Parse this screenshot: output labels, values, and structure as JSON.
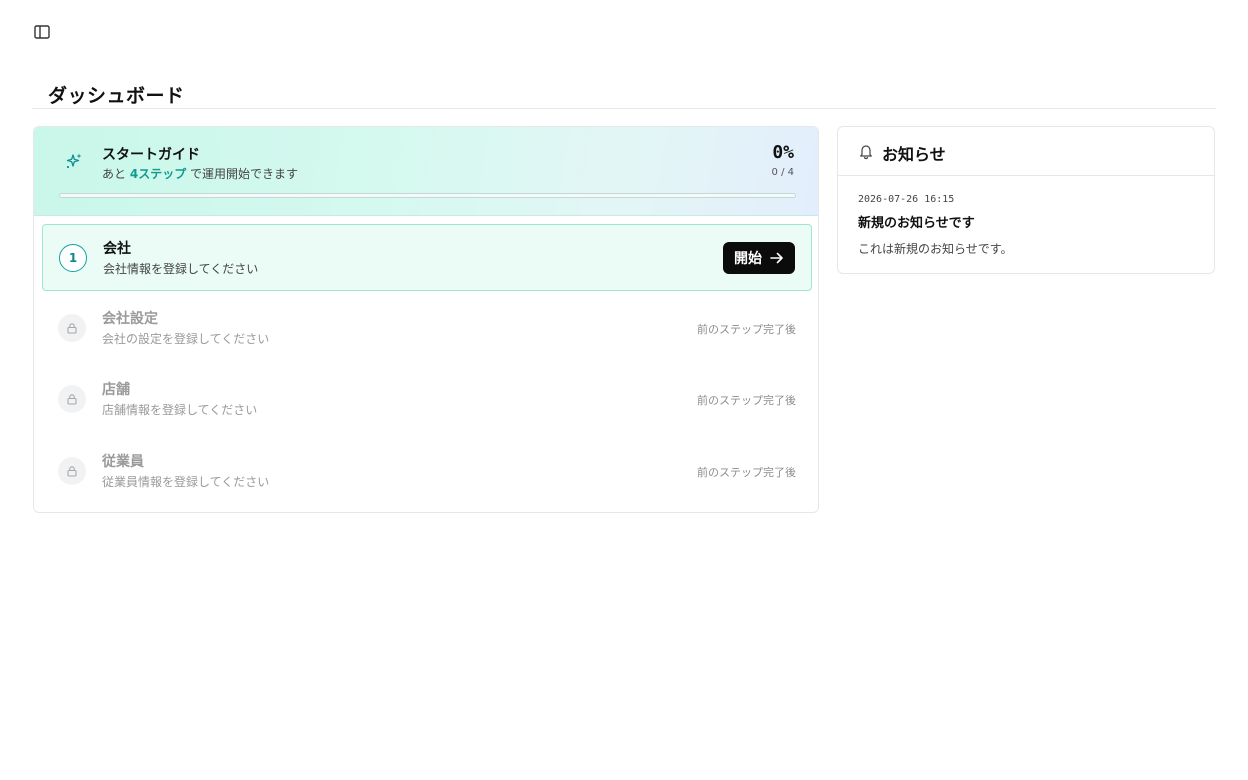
{
  "page": {
    "title": "ダッシュボード"
  },
  "guide": {
    "title": "スタートガイド",
    "subtitle_prefix": "あと",
    "subtitle_highlight": "4ステップ",
    "subtitle_suffix": "で運用開始できます",
    "percent_label": "0%",
    "count_label": "0 / 4",
    "progress_fraction": 0,
    "steps": [
      {
        "number": "1",
        "title": "会社",
        "description": "会社情報を登録してください",
        "state": "active",
        "button_label": "開始"
      },
      {
        "title": "会社設定",
        "description": "会社の設定を登録してください",
        "state": "locked",
        "status": "前のステップ完了後"
      },
      {
        "title": "店舗",
        "description": "店舗情報を登録してください",
        "state": "locked",
        "status": "前のステップ完了後"
      },
      {
        "title": "従業員",
        "description": "従業員情報を登録してください",
        "state": "locked",
        "status": "前のステップ完了後"
      }
    ]
  },
  "news": {
    "title": "お知らせ",
    "items": [
      {
        "date": "2026-07-26 16:15",
        "title": "新規のお知らせです",
        "body": "これは新規のお知らせです。"
      }
    ]
  },
  "colors": {
    "accent": "#14b8a6",
    "primary_button": "#0b0b0b"
  }
}
